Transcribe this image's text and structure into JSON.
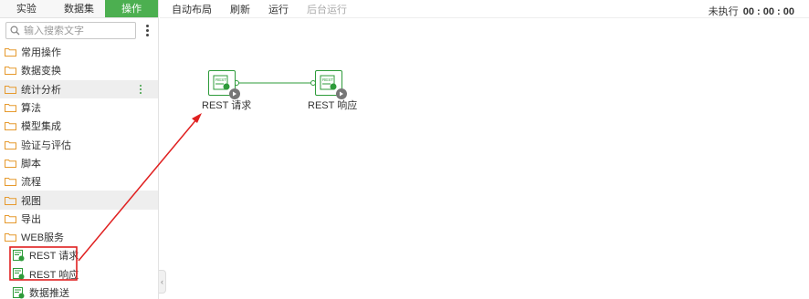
{
  "tabs": [
    {
      "label": "实验",
      "active": false
    },
    {
      "label": "数据集",
      "active": false
    },
    {
      "label": "操作",
      "active": true
    }
  ],
  "search": {
    "placeholder": "输入搜索文字"
  },
  "tree": [
    {
      "label": "常用操作",
      "type": "folder"
    },
    {
      "label": "数据变换",
      "type": "folder"
    },
    {
      "label": "统计分析",
      "type": "folder",
      "highlighted": true
    },
    {
      "label": "算法",
      "type": "folder"
    },
    {
      "label": "模型集成",
      "type": "folder"
    },
    {
      "label": "验证与评估",
      "type": "folder"
    },
    {
      "label": "脚本",
      "type": "folder"
    },
    {
      "label": "流程",
      "type": "folder"
    },
    {
      "label": "视图",
      "type": "folder",
      "highlighted": true
    },
    {
      "label": "导出",
      "type": "folder"
    },
    {
      "label": "WEB服务",
      "type": "folder"
    },
    {
      "label": "REST 请求",
      "type": "leaf"
    },
    {
      "label": "REST 响应",
      "type": "leaf"
    },
    {
      "label": "数据推送",
      "type": "leaf"
    }
  ],
  "toolbar": {
    "auto_layout": "自动布局",
    "refresh": "刷新",
    "run": "运行",
    "background_run": "后台运行",
    "status_label": "未执行",
    "status_time": "00 : 00 : 00"
  },
  "canvas": {
    "nodes": [
      {
        "label": "REST 请求",
        "icon": "rest-request-icon",
        "icon_text": "REST"
      },
      {
        "label": "REST 响应",
        "icon": "rest-response-icon",
        "icon_text": "REST"
      }
    ]
  },
  "colors": {
    "accent": "#4caf50",
    "node_border": "#2e9b3a",
    "annotation": "#e02020"
  }
}
